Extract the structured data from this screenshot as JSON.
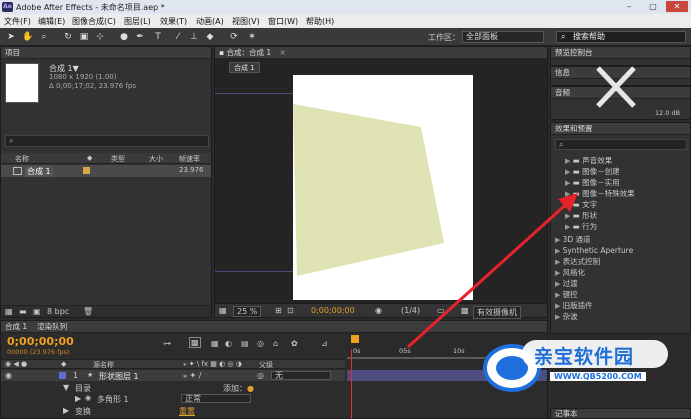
{
  "titlebar": {
    "icon": "Ae",
    "title": "Adobe After Effects - 未命名项目.aep *",
    "minimize": "–",
    "maximize": "□",
    "close": "✕"
  },
  "menu": [
    "文件(F)",
    "编辑(E)",
    "图像合成(C)",
    "图层(L)",
    "效果(T)",
    "动画(A)",
    "视图(V)",
    "窗口(W)",
    "帮助(H)"
  ],
  "toolbar": {
    "tools": [
      "arrow-tool-icon",
      "hand-tool-icon",
      "zoom-tool-icon",
      "rotate-tool-icon",
      "camera-tool-icon",
      "pan-behind-tool-icon",
      "pen-tool-icon",
      "text-tool-icon",
      "brush-tool-icon",
      "clone-tool-icon",
      "eraser-tool-icon",
      "roto-brush-icon",
      "puppet-tool-icon"
    ],
    "workspace_label": "工作区：",
    "workspace_value": "全部面板",
    "search_value": "搜索帮助"
  },
  "project": {
    "tab": "项目",
    "comp_name": "合成 1▼",
    "comp_size": "1080 x 1920 (1.00)",
    "comp_duration": "Δ 0;00;17;02, 23.976 fps",
    "search_placeholder": "",
    "col_name": "名称",
    "col_type": "类型",
    "col_size": "大小",
    "col_fps": "帧速率",
    "item_name": "合成 1",
    "item_fps": "23.976",
    "bpc": "8 bpc"
  },
  "comp_viewer": {
    "tab": "合成：合成 1",
    "subtab": "合成 1",
    "zoom": "25 %",
    "timecode": "0;00;00;00",
    "resolution": "(1/4)",
    "camera": "有效摄像机"
  },
  "right_panels": {
    "tab_preview": "预览控制台",
    "tab_info": "信息",
    "tab_audio": "音频",
    "audio_value": "12.0 dB",
    "effects_tab": "效果和预置",
    "effects_items": [
      "声音效果",
      "图像－创建",
      "图像－实用",
      "图像－特殊效果",
      "文字",
      "形状",
      "行为",
      "3D 通道",
      "Synthetic Aperture",
      "表达式控制",
      "风格化",
      "过渡",
      "键控",
      "旧版插件",
      "杂波"
    ],
    "bottom_tab": "记事本"
  },
  "timeline": {
    "tab_comp": "合成 1",
    "tab_render": "渲染队列",
    "timecode": "0;00;00;00",
    "timecode_sub": "00000 (23.976 fps)",
    "col_source": "源名称",
    "col_parent": "父级",
    "layer_num": "1",
    "layer_name": "形状图层 1",
    "layer_parent": "无",
    "contents_label": "目录",
    "add_label": "添加：",
    "polygon_label": "多角形 1",
    "blend_value": "正常",
    "transform_label": "变换",
    "reset_label": "重置",
    "ruler_ticks": [
      "0s",
      "05s",
      "10s"
    ]
  },
  "watermark": {
    "brand": "亲宝软件园",
    "url": "WWW.QB5200.COM"
  },
  "colors": {
    "bg": "#2b2b2b",
    "panel": "#323232",
    "shape_fill": "#dfe3b4",
    "accent_orange": "#f0a020",
    "arrow_red": "#e8222a",
    "watermark_blue": "#1e6fd9"
  }
}
